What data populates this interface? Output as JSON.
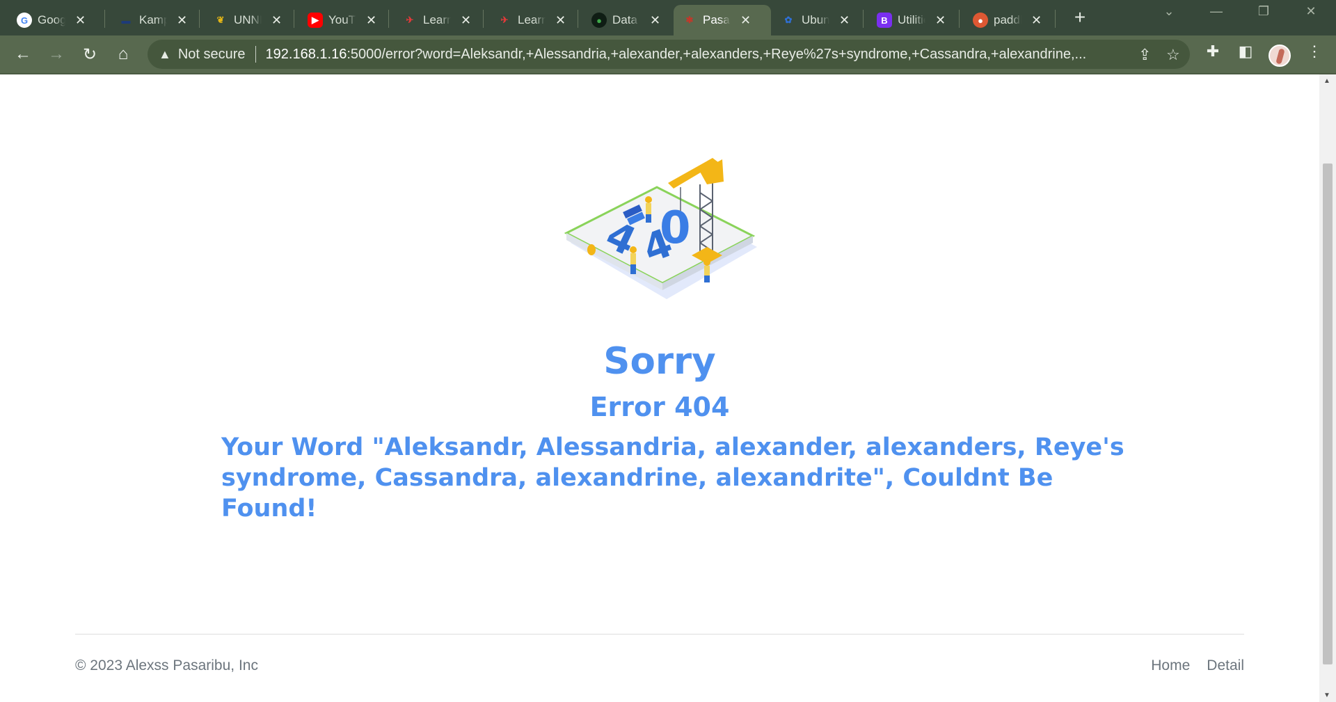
{
  "browser": {
    "tabs": [
      {
        "title": "Google",
        "icon": "google-icon",
        "color": "#ffffff"
      },
      {
        "title": "Kampus",
        "icon": "kampus-icon",
        "color": "#1d3b7a"
      },
      {
        "title": "UNNES",
        "icon": "unnes-icon",
        "color": "#e5b616"
      },
      {
        "title": "YouTube",
        "icon": "youtube-icon",
        "color": "#ff0000"
      },
      {
        "title": "Learn",
        "icon": "learn-icon",
        "color": "#e03a3a"
      },
      {
        "title": "Learn",
        "icon": "learn-icon",
        "color": "#e03a3a"
      },
      {
        "title": "Data",
        "icon": "mongodb-icon",
        "color": "#0f1d14"
      },
      {
        "title": "Pasaribu",
        "icon": "bug-icon",
        "color": "#c0392b"
      },
      {
        "title": "Ubuntu",
        "icon": "ubuntu-icon",
        "color": "#2f6fd3"
      },
      {
        "title": "Utilities",
        "icon": "bootstrap-icon",
        "color": "#7a2ff0"
      },
      {
        "title": "paddle",
        "icon": "duckduckgo-icon",
        "color": "#de5833"
      }
    ],
    "active_tab_index": 7,
    "security_label": "Not secure",
    "url_host": "192.168.1.16",
    "url_rest": ":5000/error?word=Aleksandr,+Alessandria,+alexander,+alexanders,+Reye%27s+syndrome,+Cassandra,+alexandrine,..."
  },
  "page": {
    "heading": "Sorry",
    "subheading": "Error 404",
    "message": "Your Word \"Aleksandr, Alessandria, alexander, alexanders, Reye's syndrome, Cassandra, alexandrine, alexandrite\", Couldnt Be Found!",
    "illustration_text": "404"
  },
  "footer": {
    "copyright": "© 2023 Alexss Pasaribu, Inc",
    "links": [
      "Home",
      "Detail"
    ]
  },
  "colors": {
    "accent": "#4f91ef",
    "chrome": "#58694f",
    "muted_text": "#6c757d"
  }
}
